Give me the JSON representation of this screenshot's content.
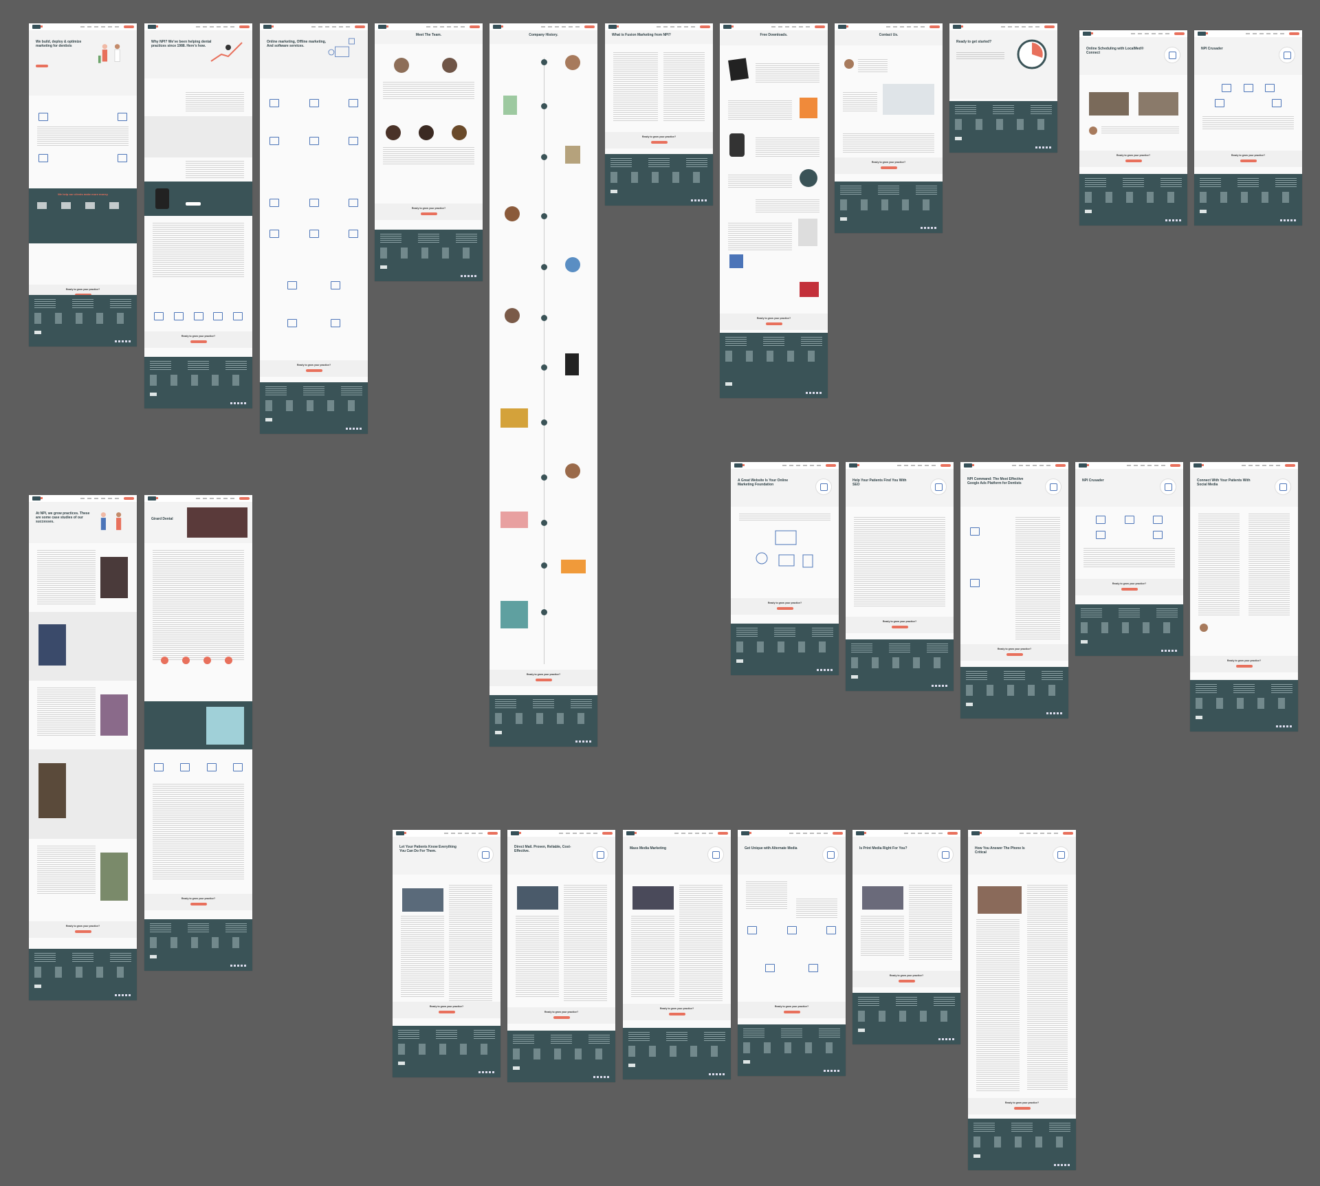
{
  "canvas": {
    "title": "",
    "background": "#5e5e5e",
    "accent": "#e8705c",
    "footer_color": "#3a5357"
  },
  "artboards": [
    {
      "id": "home",
      "title": "We build, deploy & optimize marketing for dentists",
      "band": "We help our clients make more money"
    },
    {
      "id": "why",
      "title": "Why NPI? We’ve been helping dental practices since 1988. Here’s how."
    },
    {
      "id": "services",
      "title": "Online marketing, Offline marketing, And software services."
    },
    {
      "id": "team",
      "title": "Meet The Team."
    },
    {
      "id": "history",
      "title": "Company History."
    },
    {
      "id": "fusion",
      "title": "What is Fusion Marketing from NPI?"
    },
    {
      "id": "downloads",
      "title": "Free Downloads."
    },
    {
      "id": "contact",
      "title": "Contact Us."
    },
    {
      "id": "started",
      "title": "Ready to get started?"
    },
    {
      "id": "scheduling",
      "title": "Online Scheduling with LocalMed® Connect"
    },
    {
      "id": "crusader1",
      "title": "NPI Crusader"
    },
    {
      "id": "cases",
      "title": "At NPI, we grow practices. These are some case studies of our successes."
    },
    {
      "id": "girard",
      "title": "Girard Dental"
    },
    {
      "id": "website",
      "title": "A Great Website Is Your Online Marketing Foundation"
    },
    {
      "id": "seo",
      "title": "Help Your Patients Find You With SEO"
    },
    {
      "id": "ads",
      "title": "NPI Command: The Most Effective Google Ads Platform for Dentists"
    },
    {
      "id": "crusader2",
      "title": "NPI Crusader"
    },
    {
      "id": "social",
      "title": "Connect With Your Patients With Social Media"
    },
    {
      "id": "internal",
      "title": "Let Your Patients Know Everything You Can Do For Them."
    },
    {
      "id": "directmail",
      "title": "Direct Mail. Proven, Reliable, Cost-Effective."
    },
    {
      "id": "massmedia",
      "title": "Mass Media Marketing"
    },
    {
      "id": "altmedia",
      "title": "Get Unique with Alternate Media"
    },
    {
      "id": "print",
      "title": "Is Print Media Right For You?"
    },
    {
      "id": "phone",
      "title": "How You Answer The Phone Is Critical"
    }
  ],
  "common": {
    "cta_text": "Ready to grow your practice?",
    "cta_button": "Get started"
  }
}
